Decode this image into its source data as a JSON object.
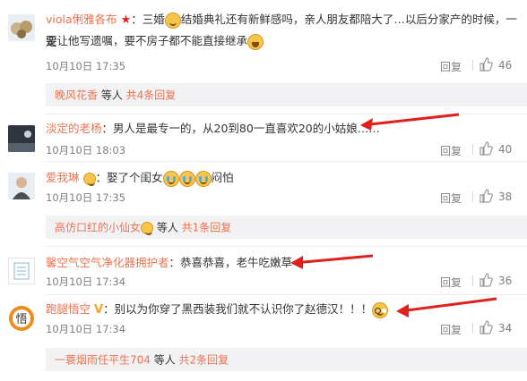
{
  "colors": {
    "link": "#eb7350",
    "meta": "#808080",
    "arrow": "#e0201c",
    "subbar_bg": "#f2f2f5"
  },
  "comments": [
    {
      "name": "viola俐雅各布",
      "text_a": "：三婚",
      "text_b": "结婚典礼还有新鲜感吗，亲人朋友都陪大了…以后分家产的时候，一定",
      "text_c": "要让他写遗嘱，要不房子都不能直接继承",
      "time": "10月10日 17:35",
      "reply": "回复",
      "likes": "46"
    },
    {
      "name": "淡定的老杨",
      "text_a": "：男人是最专一的，从20到80一直喜欢20的小姑娘……",
      "time": "10月10日 18:03",
      "reply": "回复",
      "likes": "40"
    },
    {
      "name": "爱我琳",
      "text_a": "：娶了个闺女",
      "text_b": "闷怕",
      "time": "10月10日 17:35",
      "reply": "回复",
      "likes": "38"
    },
    {
      "name": "馨空气空气净化器拥护者",
      "text_a": "：恭喜恭喜，老牛吃嫩草",
      "time": "10月10日 17:34",
      "reply": "回复",
      "likes": "36"
    },
    {
      "name": "跑腿悟空",
      "text_a": "：别以为你穿了黑西装我们就不认识你了赵德汉！！！",
      "time": "10月10日 17:34",
      "reply": "回复",
      "likes": "34"
    }
  ],
  "subreplies": [
    {
      "who": "晚风花香",
      "mid": " 等人 ",
      "count": "共4条回复"
    },
    {
      "who": "高仿口红的小仙女",
      "mid": " 等人 ",
      "count": "共1条回复"
    },
    {
      "who": "一蓑烟雨任平生704",
      "mid": " 等人 ",
      "count": "共2条回复"
    }
  ]
}
